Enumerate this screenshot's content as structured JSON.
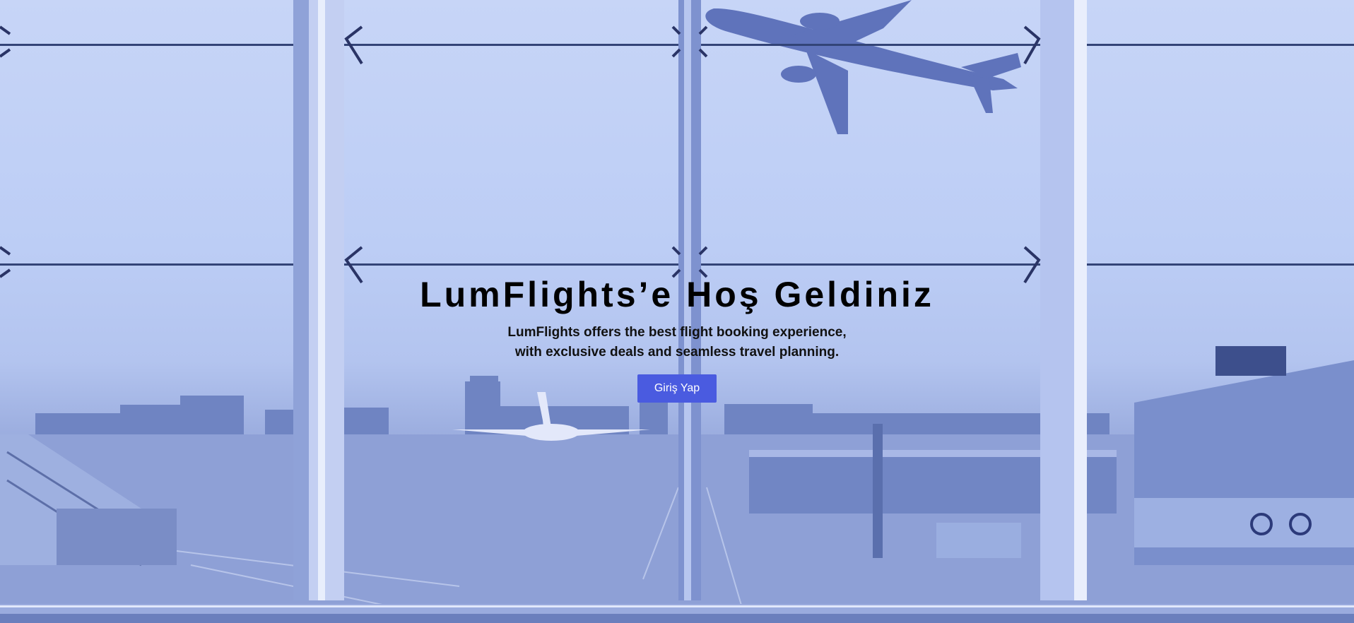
{
  "hero": {
    "title": "LumFlights’e Hoş Geldiniz",
    "subtitle_line1": "LumFlights offers the best flight booking experience,",
    "subtitle_line2": "with exclusive deals and seamless travel planning.",
    "cta_label": "Giriş Yap"
  },
  "colors": {
    "accent": "#4a5be0",
    "tint": "#b3c4ef"
  }
}
